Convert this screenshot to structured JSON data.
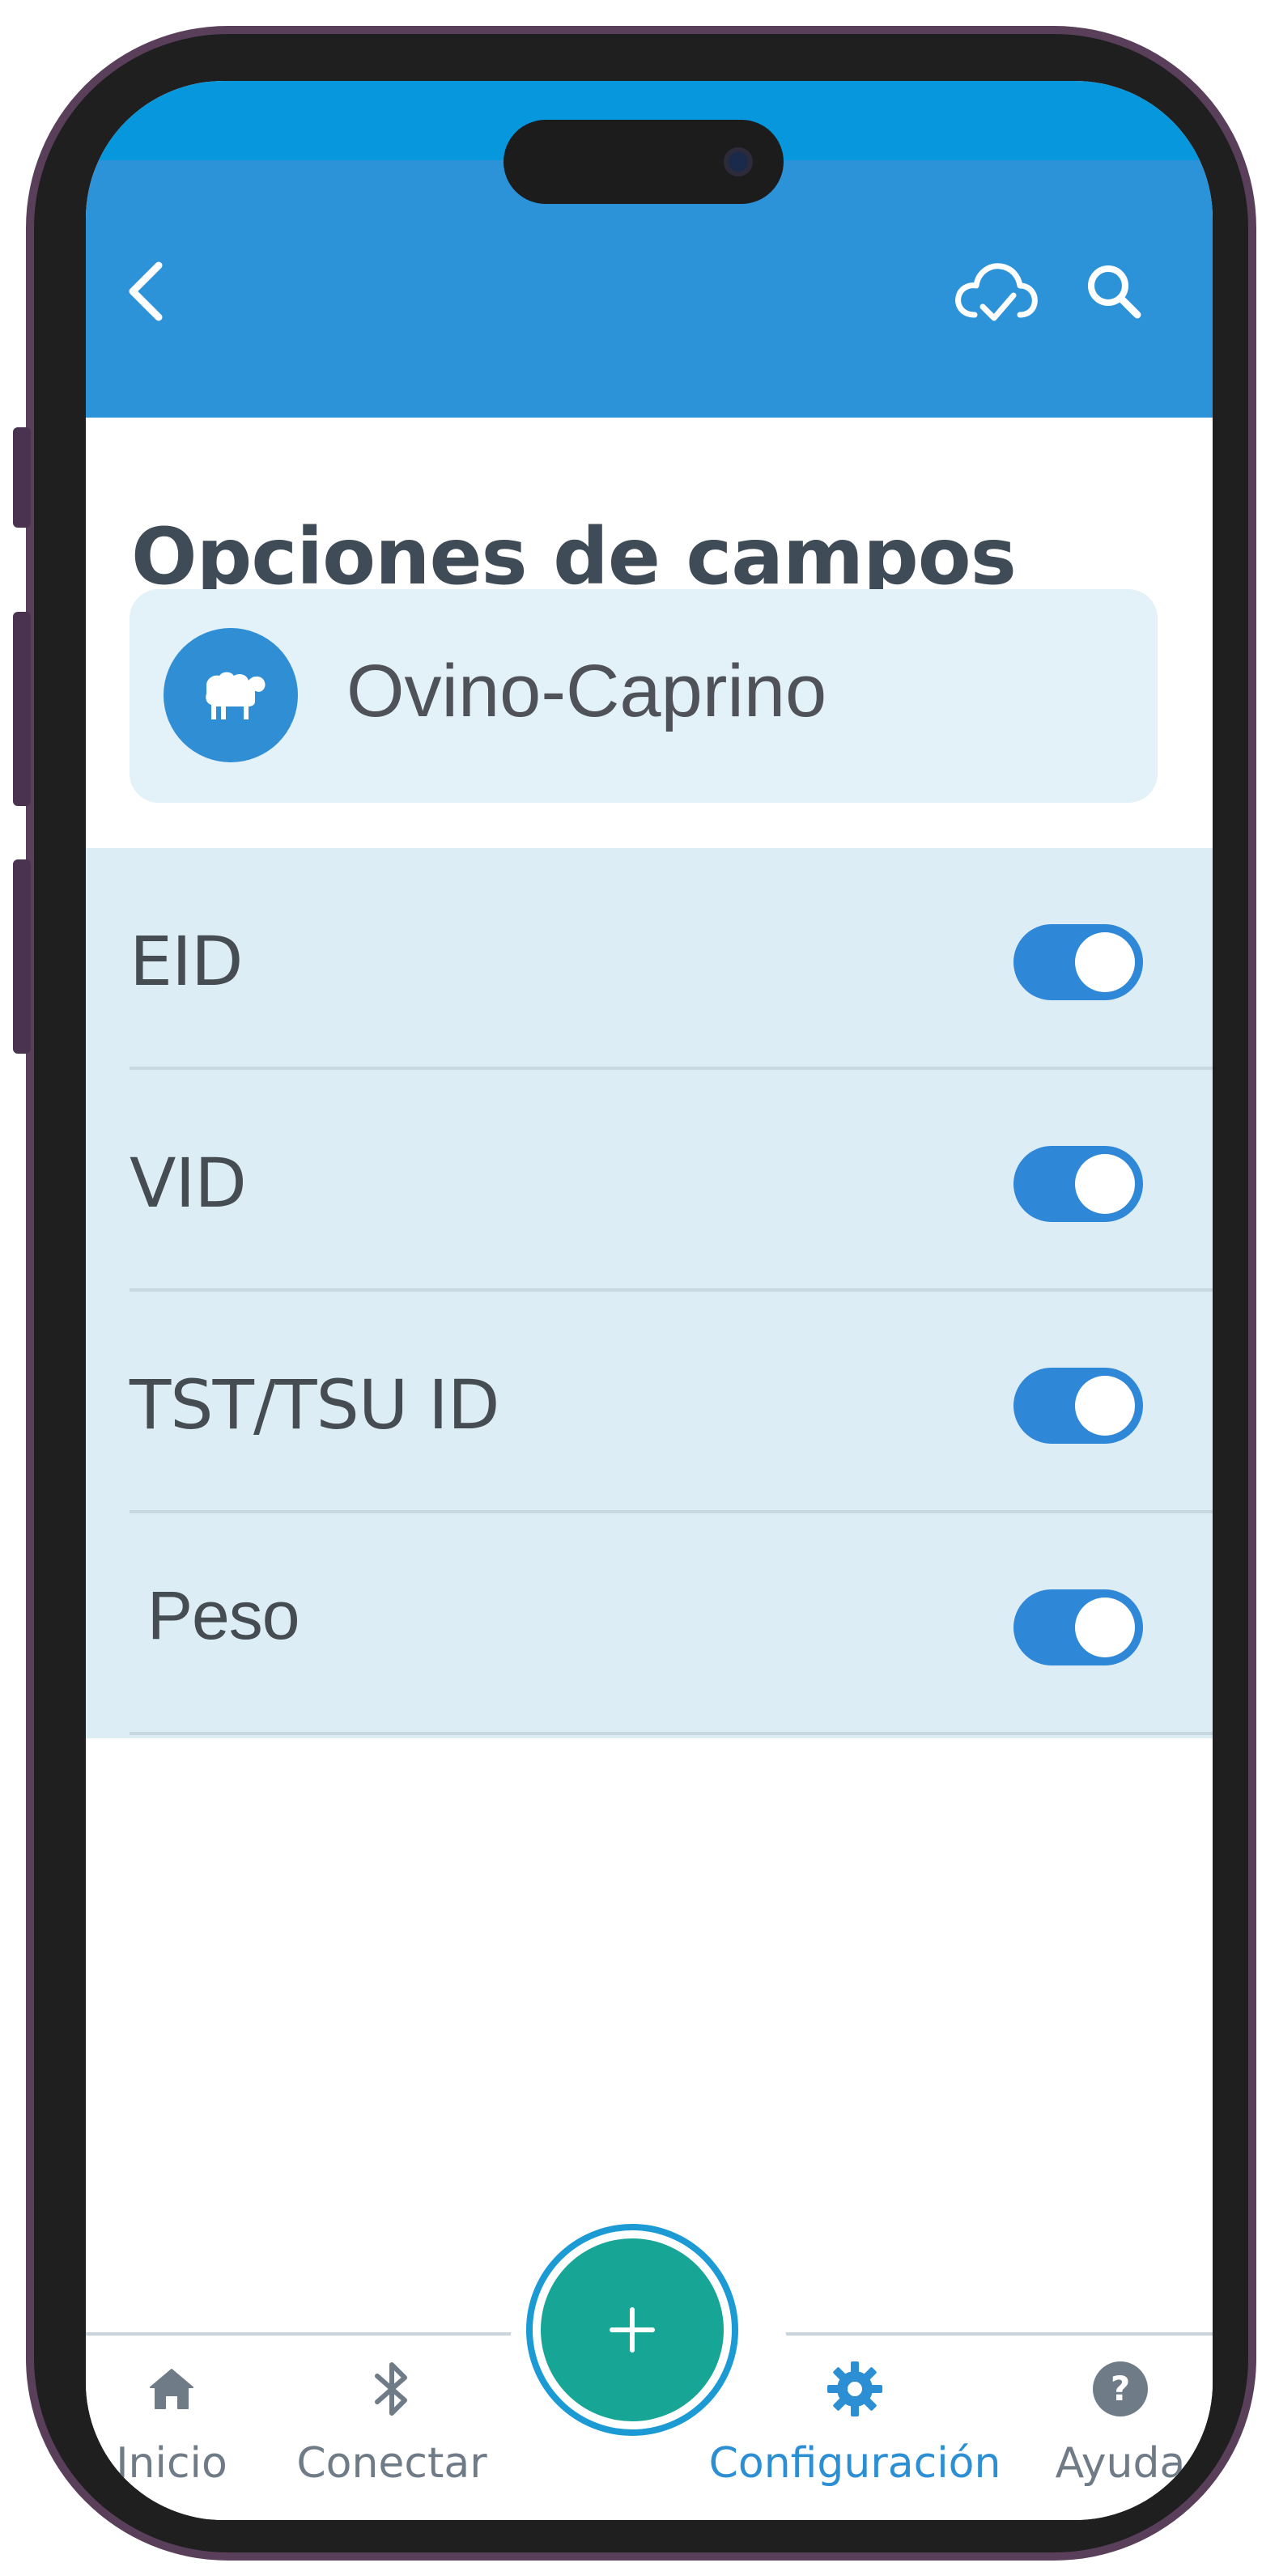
{
  "header": {
    "back_icon": "chevron-left-icon",
    "sync_icon": "cloud-check-icon",
    "search_icon": "search-icon"
  },
  "page": {
    "title": "Opciones de campos"
  },
  "species": {
    "label": "Ovino-Caprino",
    "icon": "sheep-icon"
  },
  "fields": [
    {
      "label": "EID",
      "enabled": true
    },
    {
      "label": "VID",
      "enabled": true
    },
    {
      "label": "TST/TSU ID",
      "enabled": true
    },
    {
      "label": "Peso",
      "enabled": true
    }
  ],
  "fab": {
    "icon": "plus-icon"
  },
  "bottom_nav": {
    "items": [
      {
        "label": "Inicio",
        "icon": "home-icon",
        "active": false
      },
      {
        "label": "Conectar",
        "icon": "bluetooth-icon",
        "active": false
      },
      {
        "label": "Configuración",
        "icon": "gear-icon",
        "active": true
      },
      {
        "label": "Ayuda",
        "icon": "help-icon",
        "active": false
      }
    ]
  },
  "colors": {
    "accent": "#2d93d9",
    "fab": "#17a596",
    "list_background": "#ddedf5",
    "toggle_on": "#2f87d8"
  }
}
